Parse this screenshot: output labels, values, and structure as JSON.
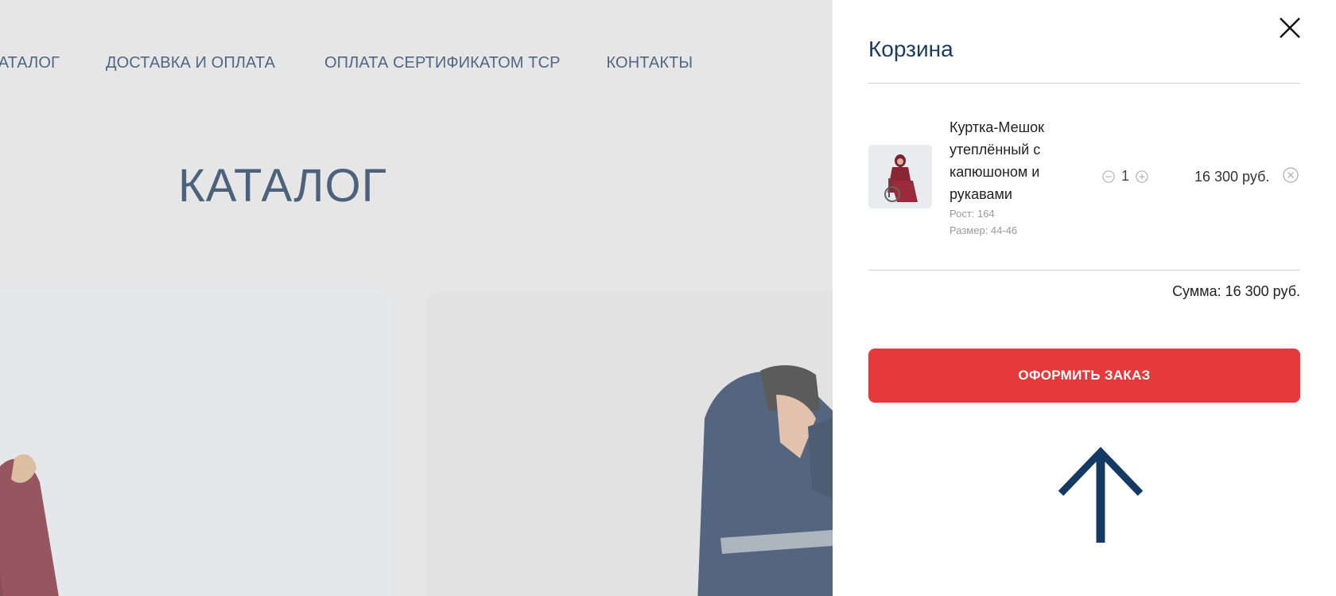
{
  "nav": {
    "items": [
      {
        "label": "КАТАЛОГ"
      },
      {
        "label": "ДОСТАВКА И ОПЛАТА"
      },
      {
        "label": "ОПЛАТА СЕРТИФИКАТОМ ТСР"
      },
      {
        "label": "КОНТАКТЫ"
      }
    ]
  },
  "page": {
    "title": "КАТАЛОГ"
  },
  "cart": {
    "title": "Корзина",
    "item": {
      "name": "Куртка-Мешок утеплённый с капюшоном и рукавами",
      "options": [
        "Рост: 164",
        "Размер: 44-46"
      ],
      "quantity": "1",
      "price": "16 300 руб."
    },
    "total": "Сумма: 16 300 руб.",
    "checkout_label": "ОФОРМИТЬ ЗАКАЗ"
  },
  "icons": {
    "close": "close-icon",
    "minus": "minus-circle-icon",
    "plus": "plus-circle-icon",
    "remove": "remove-circle-icon",
    "arrow": "arrow-up-icon"
  },
  "colors": {
    "brand_navy": "#1c3b63",
    "checkout_red": "#e5393b",
    "page_bg": "#e6e6e6"
  }
}
